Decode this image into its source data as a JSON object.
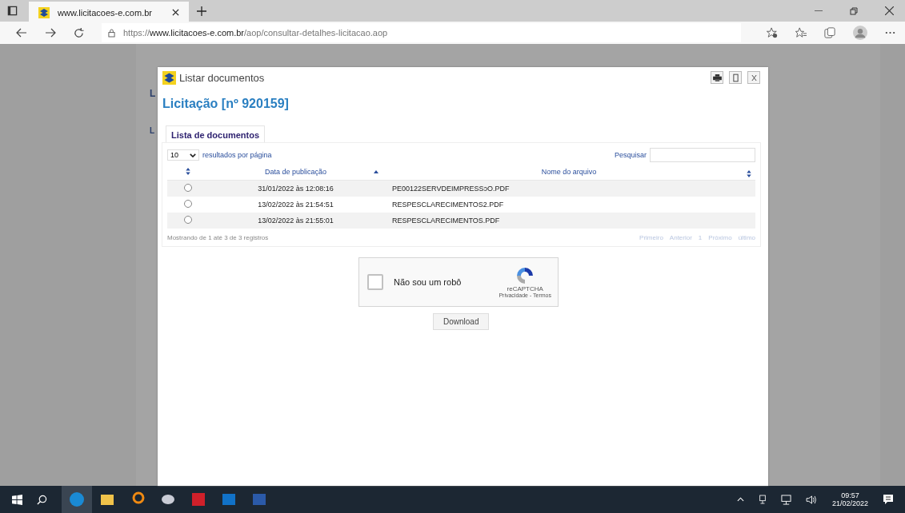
{
  "browser": {
    "tab": {
      "title": "www.licitacoes-e.com.br"
    },
    "url": {
      "scheme": "https://",
      "host": "www.licitacoes-e.com.br",
      "path": "/aop/consultar-detalhes-licitacao.aop"
    }
  },
  "background_page": {
    "fragments": [
      "L",
      "L"
    ]
  },
  "dialog": {
    "title": "Listar documentos",
    "heading": "Licitação [nº 920159]",
    "tab": "Lista de documentos",
    "page_size": {
      "value": "10",
      "label": "resultados por página"
    },
    "search": {
      "label": "Pesquisar"
    },
    "columns": [
      "Data de publicação",
      "Nome do arquivo"
    ],
    "rows": [
      {
        "selected": false,
        "date": "31/01/2022 às 12:08:16",
        "file": "PE00122SERVDEIMPRESSɔO.PDF"
      },
      {
        "selected": false,
        "date": "13/02/2022 às 21:54:51",
        "file": "RESPESCLARECIMENTOS2.PDF"
      },
      {
        "selected": false,
        "date": "13/02/2022 às 21:55:01",
        "file": "RESPESCLARECIMENTOS.PDF"
      }
    ],
    "info": "Mostrando de 1 até 3 de 3 registros",
    "pagination": [
      {
        "label": "Primeiro",
        "disabled": true
      },
      {
        "label": "Anterior",
        "disabled": true
      },
      {
        "label": "1",
        "disabled": true
      },
      {
        "label": "Próximo",
        "disabled": true
      },
      {
        "label": "último",
        "disabled": true
      }
    ],
    "captcha": {
      "label": "Não sou um robô",
      "checked": false,
      "brand": "reCAPTCHA",
      "links": "Privacidade - Termos"
    },
    "download": "Download"
  },
  "taskbar": {
    "time": "09:57",
    "date": "21/02/2022"
  }
}
